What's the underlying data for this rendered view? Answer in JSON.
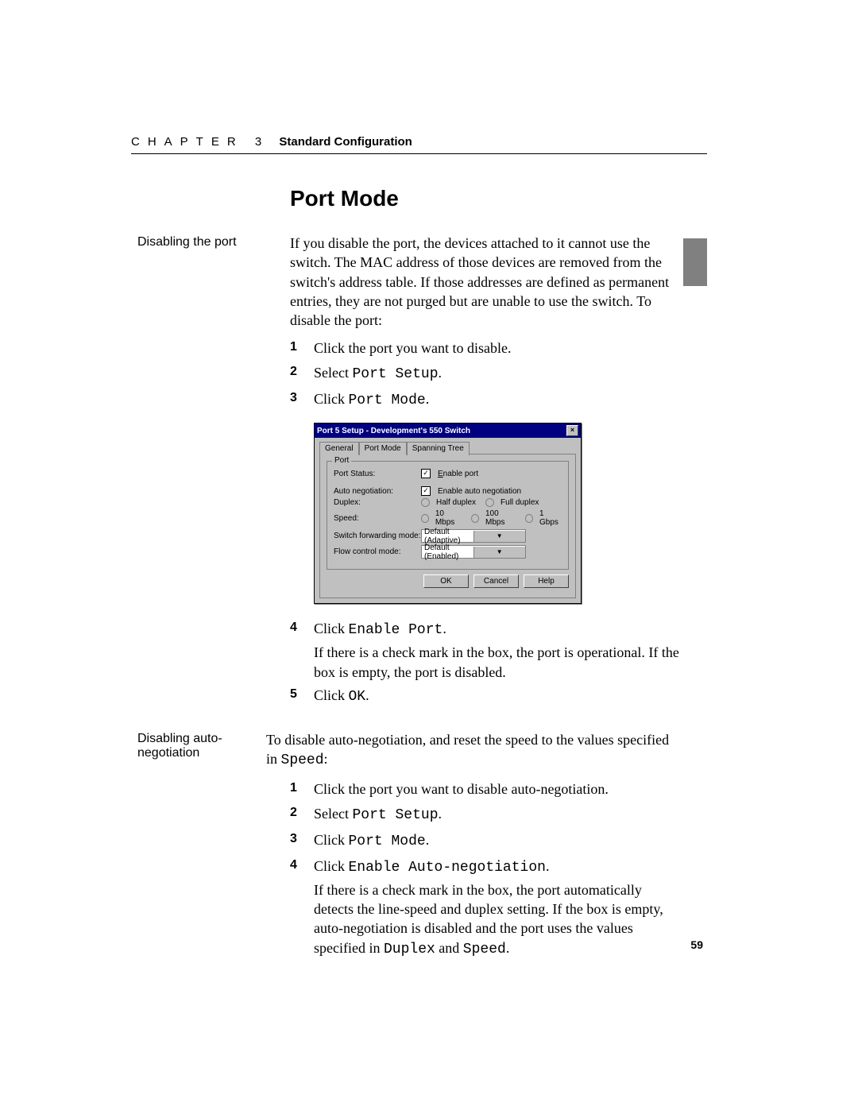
{
  "header": {
    "chapter": "CHAPTER 3",
    "title": "Standard Configuration"
  },
  "page_number": "59",
  "section_title": "Port Mode",
  "block1": {
    "sidenote": "Disabling the port",
    "intro": "If you disable the port, the devices attached to it cannot use the switch. The MAC address of those devices are removed from the switch's address table. If those addresses are defined as permanent entries, they are not purged but are unable to use the switch. To disable the port:",
    "steps": {
      "s1": {
        "num": "1",
        "text": "Click the port you want to disable."
      },
      "s2": {
        "num": "2",
        "pre": "Select ",
        "mono": "Port Setup",
        "post": "."
      },
      "s3": {
        "num": "3",
        "pre": "Click ",
        "mono": "Port Mode",
        "post": "."
      },
      "s4": {
        "num": "4",
        "pre": "Click ",
        "mono": "Enable Port",
        "post": ".",
        "body": "If there is a check mark in the box, the port is operational. If the box is empty, the port is disabled."
      },
      "s5": {
        "num": "5",
        "pre": "Click ",
        "mono": "OK",
        "post": "."
      }
    }
  },
  "dialog": {
    "title": "Port 5 Setup - Development's 550 Switch",
    "tabs": {
      "general": "General",
      "port_mode": "Port Mode",
      "spanning": "Spanning Tree"
    },
    "group_label": "Port",
    "rows": {
      "status": {
        "label": "Port Status:",
        "check": "✓",
        "opt_pre": "E",
        "opt_rest": "nable port"
      },
      "autoneg": {
        "label": "Auto negotiation:",
        "check": "✓",
        "opt": "Enable auto negotiation"
      },
      "duplex": {
        "label": "Duplex:",
        "opt1": "Half duplex",
        "opt2": "Full duplex"
      },
      "speed": {
        "label": "Speed:",
        "opt1": "10 Mbps",
        "opt2": "100 Mbps",
        "opt3": "1 Gbps"
      },
      "fwd": {
        "label": "Switch forwarding mode:",
        "value": "Default (Adaptive)"
      },
      "flow": {
        "label": "Flow control mode:",
        "value": "Default (Enabled)"
      }
    },
    "buttons": {
      "ok": "OK",
      "cancel": "Cancel",
      "help": "Help"
    }
  },
  "block2": {
    "sidenote": "Disabling auto-negotiation",
    "intro_pre": "To disable auto-negotiation, and reset the speed to the values specified in ",
    "intro_mono": "Speed",
    "intro_post": ":",
    "steps": {
      "s1": {
        "num": "1",
        "text": "Click the port you want to disable auto-negotiation."
      },
      "s2": {
        "num": "2",
        "pre": "Select ",
        "mono": "Port Setup",
        "post": "."
      },
      "s3": {
        "num": "3",
        "pre": "Click ",
        "mono": "Port Mode",
        "post": "."
      },
      "s4": {
        "num": "4",
        "pre": "Click ",
        "mono": "Enable Auto-negotiation",
        "post": ".",
        "body_pre": "If there is a check mark in the box, the port automatically detects the line-speed and duplex setting. If the box is empty, auto-negotiation is disabled and the port uses the values specified in ",
        "body_mono1": "Duplex",
        "body_mid": " and ",
        "body_mono2": "Speed",
        "body_post": "."
      }
    }
  }
}
